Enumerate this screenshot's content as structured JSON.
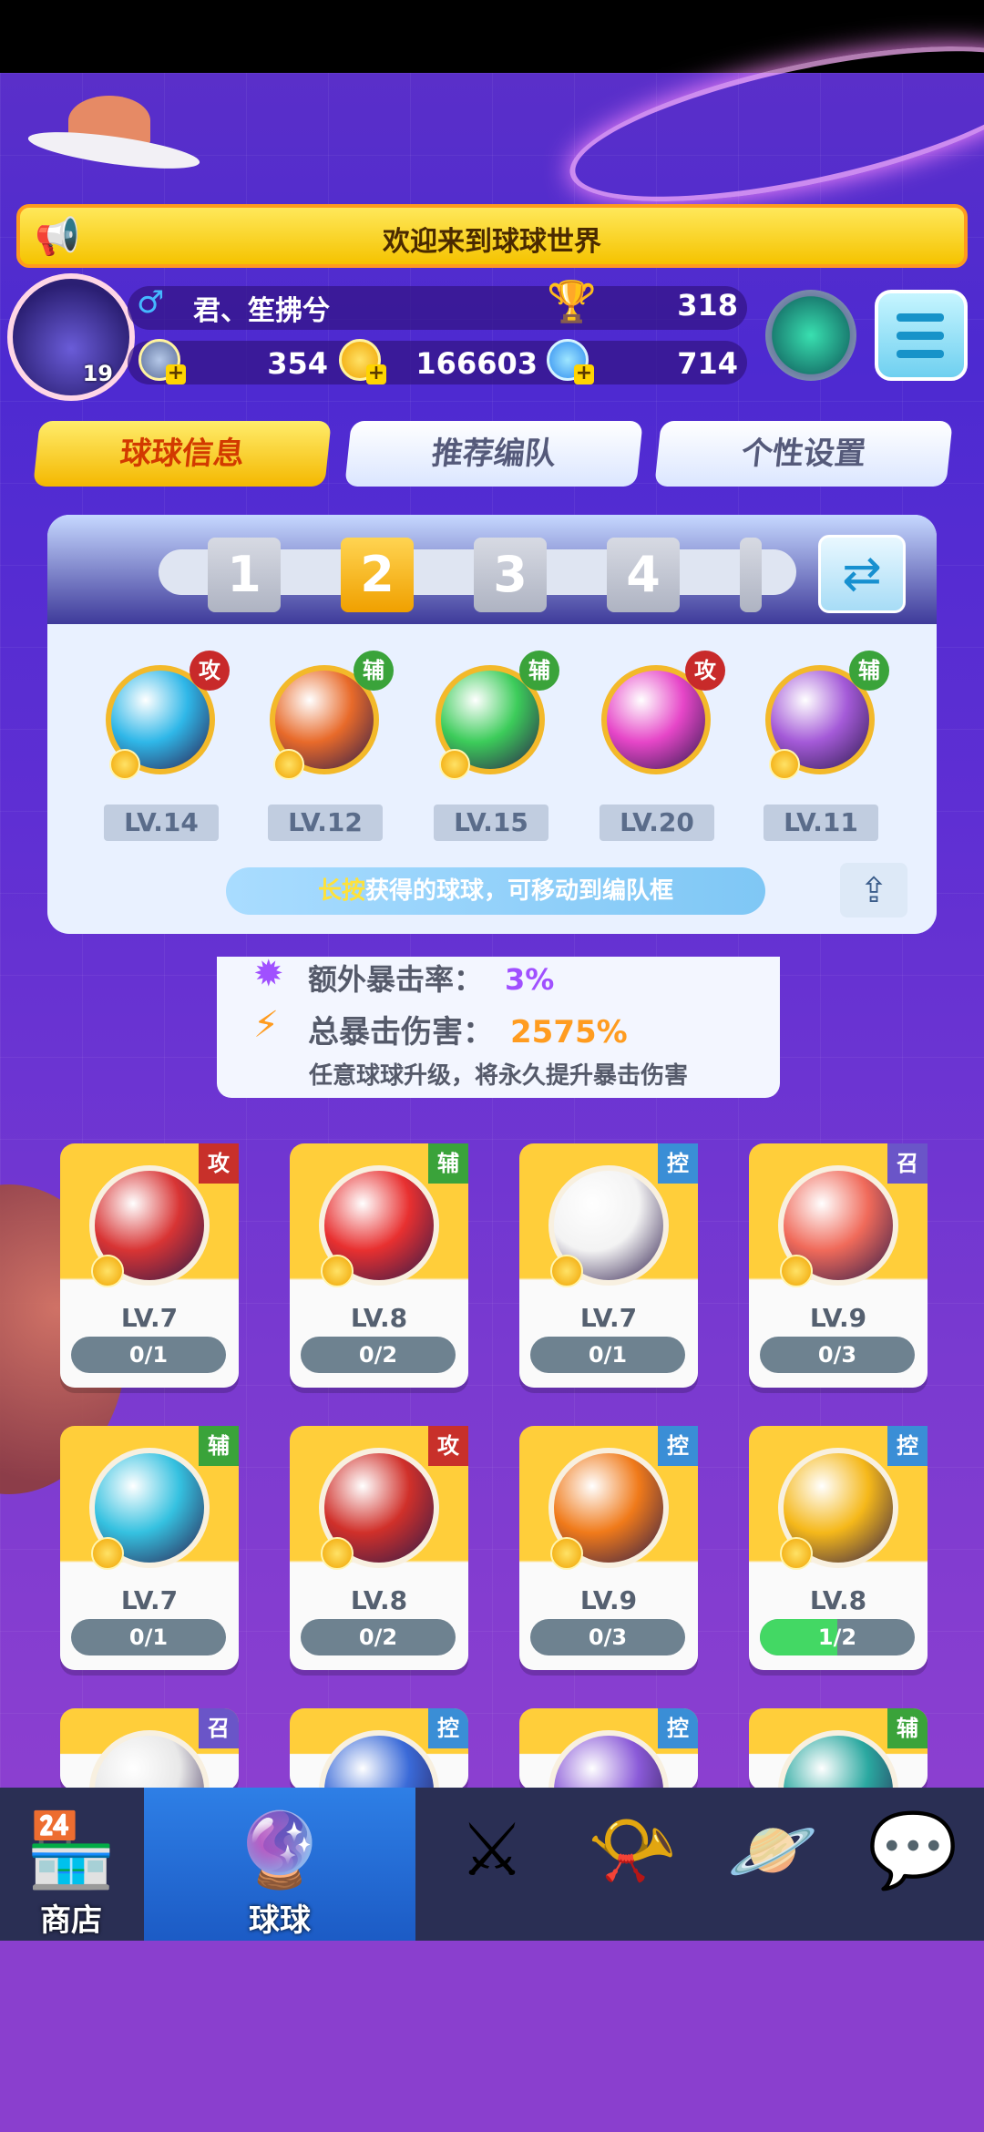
{
  "announcement": "欢迎来到球球世界",
  "profile": {
    "level": "19",
    "gender_symbol": "♂",
    "username": "君、笙拂兮",
    "trophies": "318",
    "stamina": "354",
    "coins": "166603",
    "diamonds": "714"
  },
  "tabs": [
    "球球信息",
    "推荐编队",
    "个性设置"
  ],
  "team": {
    "slots": [
      "1",
      "2",
      "3",
      "4"
    ],
    "selected_slot": "2",
    "balls": [
      {
        "tag": "攻",
        "level": "LV.14",
        "color": "#2fb7e8"
      },
      {
        "tag": "辅",
        "level": "LV.12",
        "color": "#e86a2a"
      },
      {
        "tag": "辅",
        "level": "LV.15",
        "color": "#3ccc5a"
      },
      {
        "tag": "攻",
        "level": "LV.20",
        "color": "#e646c8"
      },
      {
        "tag": "辅",
        "level": "LV.11",
        "color": "#a45ad8"
      }
    ],
    "hint_highlight": "长按",
    "hint_text": "获得的球球，可移动到编队框"
  },
  "crit": {
    "extra_label": "额外暴击率：",
    "extra_value": "3%",
    "total_label": "总暴击伤害：",
    "total_value": "2575%",
    "note": "任意球球升级，将永久提升暴击伤害"
  },
  "collection": [
    {
      "tag": "攻",
      "level": "LV.7",
      "progress": "0/1",
      "ratio": 0,
      "color": "#d83434",
      "tag_color": "#c8302a"
    },
    {
      "tag": "辅",
      "level": "LV.8",
      "progress": "0/2",
      "ratio": 0,
      "color": "#e83030",
      "tag_color": "#3aa33a"
    },
    {
      "tag": "控",
      "level": "LV.7",
      "progress": "0/1",
      "ratio": 0,
      "color": "#f3f3f3",
      "tag_color": "#3a8ed6"
    },
    {
      "tag": "召",
      "level": "LV.9",
      "progress": "0/3",
      "ratio": 0,
      "color": "#f06a5a",
      "tag_color": "#6a55c8"
    },
    {
      "tag": "辅",
      "level": "LV.7",
      "progress": "0/1",
      "ratio": 0,
      "color": "#35c1e0",
      "tag_color": "#3aa33a"
    },
    {
      "tag": "攻",
      "level": "LV.8",
      "progress": "0/2",
      "ratio": 0,
      "color": "#d0302a",
      "tag_color": "#c8302a"
    },
    {
      "tag": "控",
      "level": "LV.9",
      "progress": "0/3",
      "ratio": 0,
      "color": "#f07a1a",
      "tag_color": "#3a8ed6"
    },
    {
      "tag": "控",
      "level": "LV.8",
      "progress": "1/2",
      "ratio": 0.5,
      "color": "#f5b81a",
      "tag_color": "#3a8ed6"
    },
    {
      "tag": "召",
      "color": "#e8e8e8",
      "tag_color": "#6a55c8"
    },
    {
      "tag": "控",
      "color": "#3a6ad8",
      "tag_color": "#3a8ed6"
    },
    {
      "tag": "控",
      "color": "#8a5ad8",
      "tag_color": "#3a8ed6"
    },
    {
      "tag": "辅",
      "color": "#2aa8a0",
      "tag_color": "#3aa33a"
    }
  ],
  "nav": [
    {
      "label": "商店",
      "icon": "shop-icon",
      "active": false
    },
    {
      "label": "球球",
      "icon": "balls-icon",
      "active": true
    },
    {
      "label": "",
      "icon": "crossed-swords-icon",
      "active": false
    },
    {
      "label": "",
      "icon": "whistle-icon",
      "active": false
    },
    {
      "label": "",
      "icon": "planet-icon",
      "active": false
    },
    {
      "label": "",
      "icon": "chat-heart-icon",
      "active": false
    }
  ]
}
